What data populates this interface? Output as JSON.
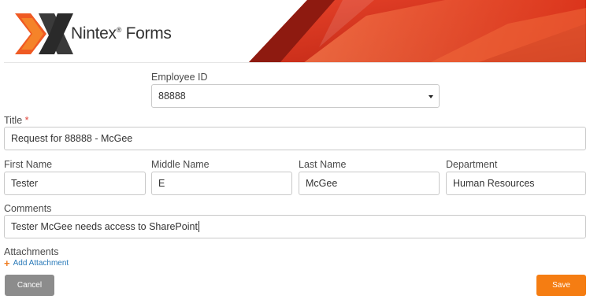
{
  "header": {
    "brand_name": "Nintex",
    "brand_mark": "®",
    "brand_product": "Forms",
    "colors": {
      "banner_red": "#c8281a",
      "banner_orange": "#f0642d",
      "logo_gray": "#3a3a3a"
    }
  },
  "form": {
    "employee_id": {
      "label": "Employee ID",
      "value": "88888"
    },
    "title": {
      "label": "Title",
      "required_marker": "*",
      "value": "Request for 88888 - McGee"
    },
    "first_name": {
      "label": "First Name",
      "value": "Tester"
    },
    "middle_name": {
      "label": "Middle Name",
      "value": "E"
    },
    "last_name": {
      "label": "Last Name",
      "value": "McGee"
    },
    "department": {
      "label": "Department",
      "value": "Human Resources"
    },
    "comments": {
      "label": "Comments",
      "value": "Tester McGee needs access to SharePoint"
    },
    "attachments": {
      "label": "Attachments",
      "add_label": "Add Attachment",
      "add_icon": "plus-icon"
    }
  },
  "actions": {
    "cancel_label": "Cancel",
    "save_label": "Save",
    "colors": {
      "cancel": "#8c8c8c",
      "save": "#f57d12"
    }
  }
}
